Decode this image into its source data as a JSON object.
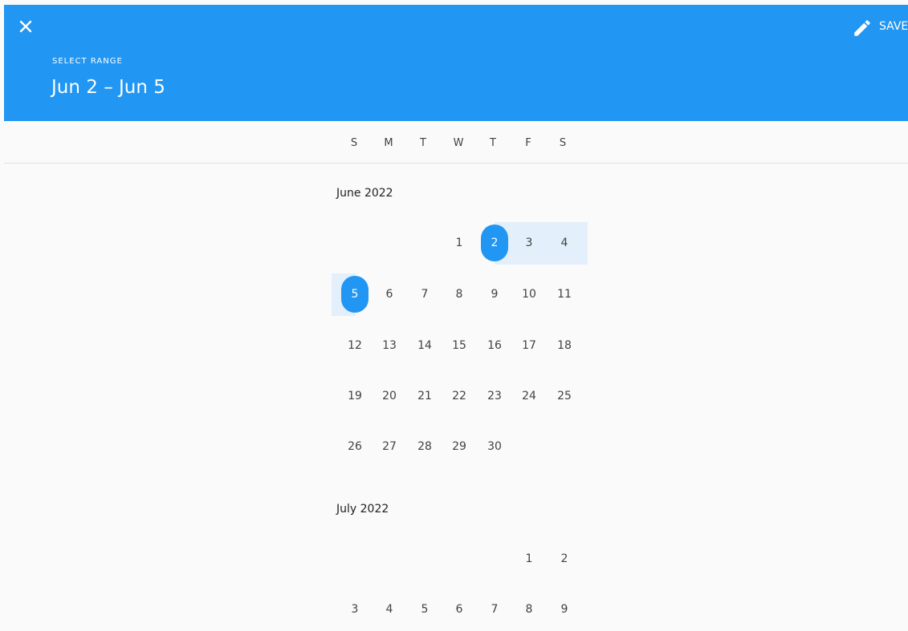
{
  "header": {
    "close_icon": "close-icon",
    "caption": "SELECT RANGE",
    "range_text": "Jun 2 – Jun 5",
    "edit_icon": "pencil-icon",
    "save_label": "SAVE",
    "color": "#2196f3"
  },
  "weekdays": [
    "S",
    "M",
    "T",
    "W",
    "T",
    "F",
    "S"
  ],
  "months": [
    {
      "title": "June 2022",
      "weeks": [
        [
          "",
          "",
          "",
          "1",
          "2",
          "3",
          "4"
        ],
        [
          "5",
          "6",
          "7",
          "8",
          "9",
          "10",
          "11"
        ],
        [
          "12",
          "13",
          "14",
          "15",
          "16",
          "17",
          "18"
        ],
        [
          "19",
          "20",
          "21",
          "22",
          "23",
          "24",
          "25"
        ],
        [
          "26",
          "27",
          "28",
          "29",
          "30",
          "",
          ""
        ]
      ]
    },
    {
      "title": "July 2022",
      "weeks": [
        [
          "",
          "",
          "",
          "",
          "",
          "1",
          "2"
        ],
        [
          "3",
          "4",
          "5",
          "6",
          "7",
          "8",
          "9"
        ]
      ]
    }
  ],
  "selection": {
    "start": "2",
    "end": "5",
    "accent": "#2196f3",
    "range_fill": "#e3f0fb"
  }
}
